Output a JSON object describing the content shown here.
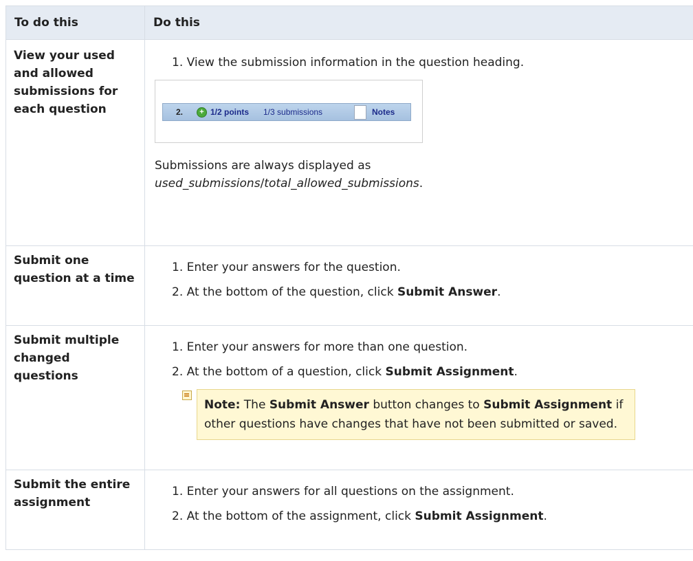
{
  "header": {
    "col1": "To do this",
    "col2": "Do this"
  },
  "rows": [
    {
      "task": "View your used and allowed submissions for each question",
      "steps": [
        "1. View the submission information in the question heading."
      ],
      "screenshot": {
        "number": "2.",
        "points": "1/2 points",
        "submissions": "1/3 submissions",
        "notes": "Notes"
      },
      "after_text": "Submissions are always displayed as",
      "after_italic": "used_submissions",
      "after_sep": "/",
      "after_italic2": "total_allowed_submissions",
      "after_end": "."
    },
    {
      "task": "Submit one question at a time",
      "steps": [
        {
          "text": "1. Enter your answers for the question.",
          "bold": "",
          "end": ""
        },
        {
          "text": "2. At the bottom of the question, click ",
          "bold": "Submit Answer",
          "end": "."
        }
      ]
    },
    {
      "task": "Submit multiple changed questions",
      "steps": [
        {
          "text": "1. Enter your answers for more than one question.",
          "bold": "",
          "end": ""
        },
        {
          "text": "2. At the bottom of a question, click ",
          "bold": "Submit Assignment",
          "end": "."
        }
      ],
      "note": {
        "label": "Note:",
        "t1": " The ",
        "b1": "Submit Answer",
        "t2": " button changes to ",
        "b2": "Submit Assignment",
        "t3": " if other questions have changes that have not been submitted or saved."
      }
    },
    {
      "task": "Submit the entire assignment",
      "steps": [
        {
          "text": "1. Enter your answers for all questions on the assignment.",
          "bold": "",
          "end": ""
        },
        {
          "text": "2. At the bottom of the assignment, click ",
          "bold": "Submit Assignment",
          "end": "."
        }
      ]
    }
  ]
}
